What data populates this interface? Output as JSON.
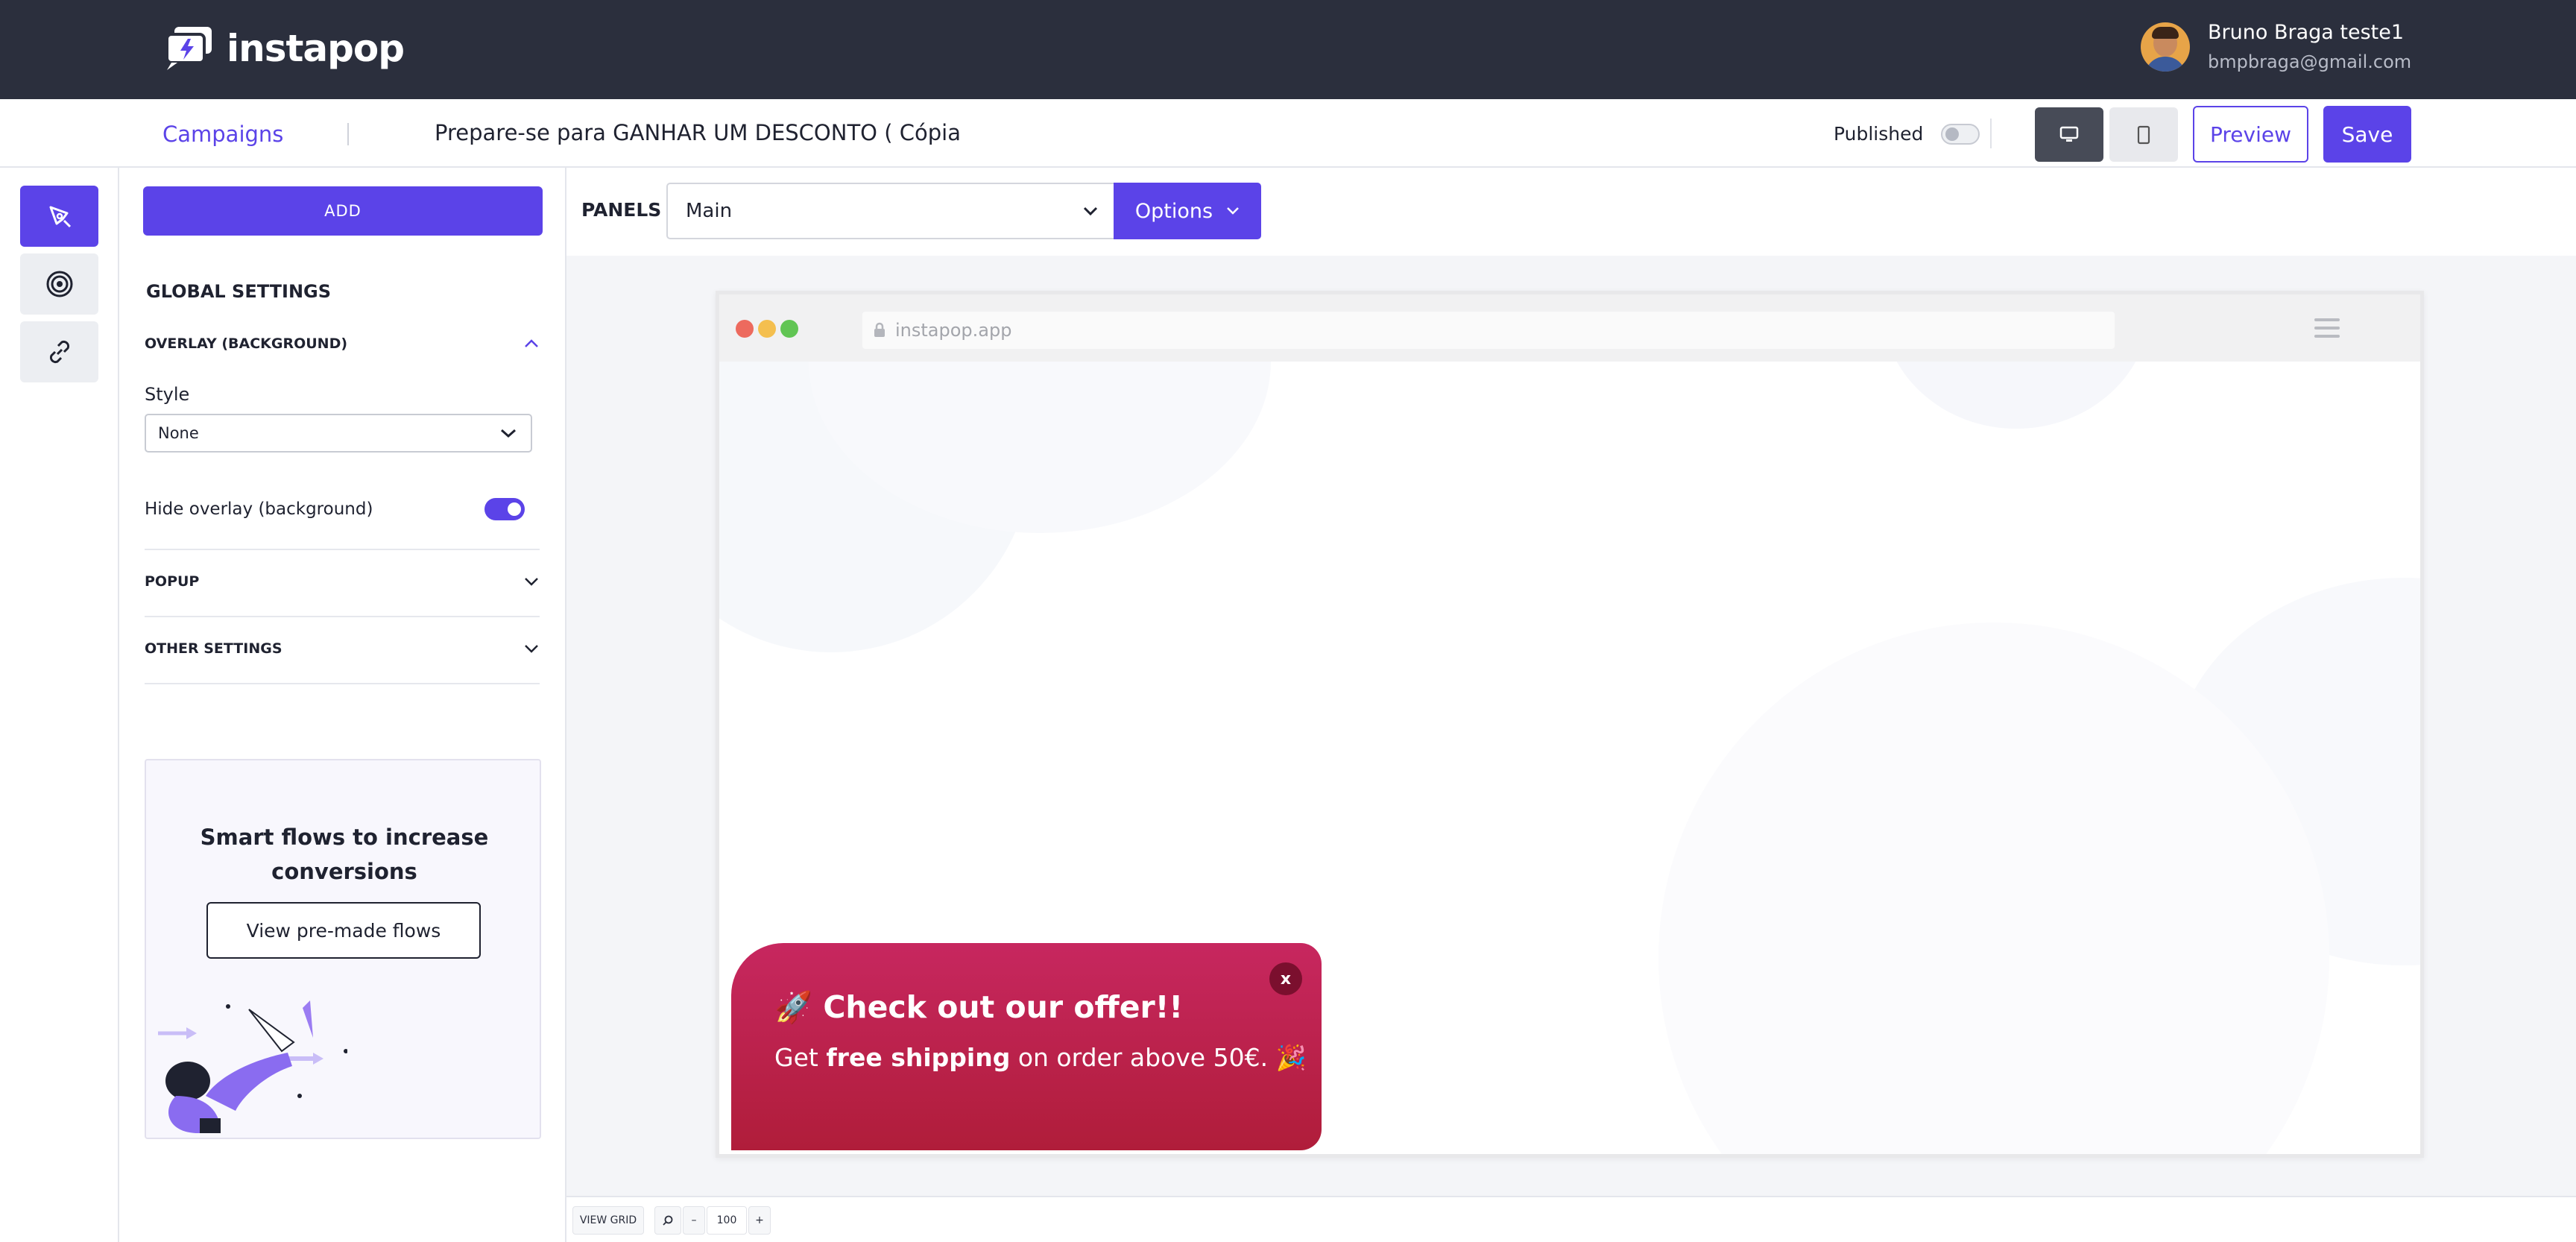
{
  "app": {
    "logo_text": "instapop"
  },
  "user": {
    "name": "Bruno Braga teste1",
    "email": "bmpbraga@gmail.com"
  },
  "header": {
    "breadcrumb_link": "Campaigns",
    "campaign_title": "Prepare-se para GANHAR UM DESCONTO ( Cópia",
    "published_label": "Published",
    "preview_label": "Preview",
    "save_label": "Save"
  },
  "sidebar": {
    "add_label": "ADD",
    "global_settings": "GLOBAL SETTINGS",
    "sections": {
      "overlay": "OVERLAY (BACKGROUND)",
      "popup": "POPUP",
      "other": "OTHER SETTINGS"
    },
    "style_label": "Style",
    "style_value": "None",
    "hide_overlay_label": "Hide overlay (background)",
    "promo": {
      "title": "Smart flows to increase conversions",
      "button": "View pre-made flows"
    }
  },
  "canvas": {
    "panels_label": "PANELS",
    "panel_select_value": "Main",
    "options_label": "Options",
    "url": "instapop.app"
  },
  "popup": {
    "close_label": "x",
    "title": "🚀 Check out our offer!!",
    "text_prefix": "Get ",
    "text_bold": "free shipping",
    "text_suffix": " on order above 50€. 🎉"
  },
  "bottom_bar": {
    "view_grid": "VIEW GRID",
    "zoom_minus": "–",
    "zoom_value": "100",
    "zoom_plus": "+"
  },
  "colors": {
    "accent": "#5b43e8",
    "topbar": "#2b2f3d",
    "popup_top": "#c7275f",
    "popup_bottom": "#b01d3a"
  }
}
